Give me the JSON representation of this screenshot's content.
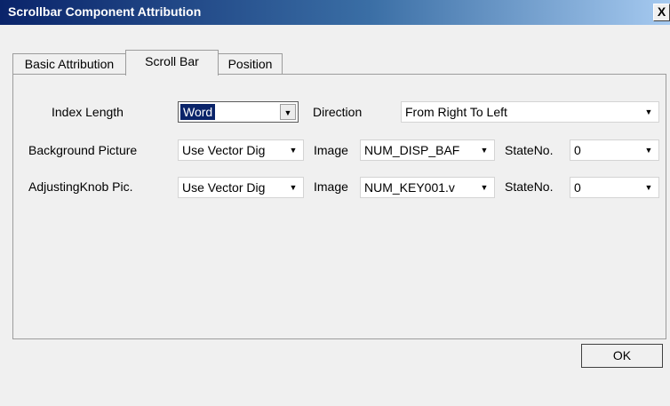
{
  "window": {
    "title": "Scrollbar Component Attribution",
    "close_label": "X"
  },
  "tabs": [
    {
      "label": "Basic Attribution"
    },
    {
      "label": "Scroll Bar"
    },
    {
      "label": "Position"
    }
  ],
  "rows": {
    "index_length": {
      "label": "Index Length",
      "value": "Word"
    },
    "direction": {
      "label": "Direction",
      "value": "From Right To Left"
    },
    "background": {
      "label": "Background Picture",
      "picture_value": "Use Vector Dig",
      "image_label": "Image",
      "image_value": "NUM_DISP_BAF",
      "state_label": "StateNo.",
      "state_value": "0"
    },
    "knob": {
      "label": "AdjustingKnob Pic.",
      "picture_value": "Use Vector Dig",
      "image_label": "Image",
      "image_value": "NUM_KEY001.v",
      "state_label": "StateNo.",
      "state_value": "0"
    }
  },
  "footer": {
    "ok_label": "OK"
  }
}
